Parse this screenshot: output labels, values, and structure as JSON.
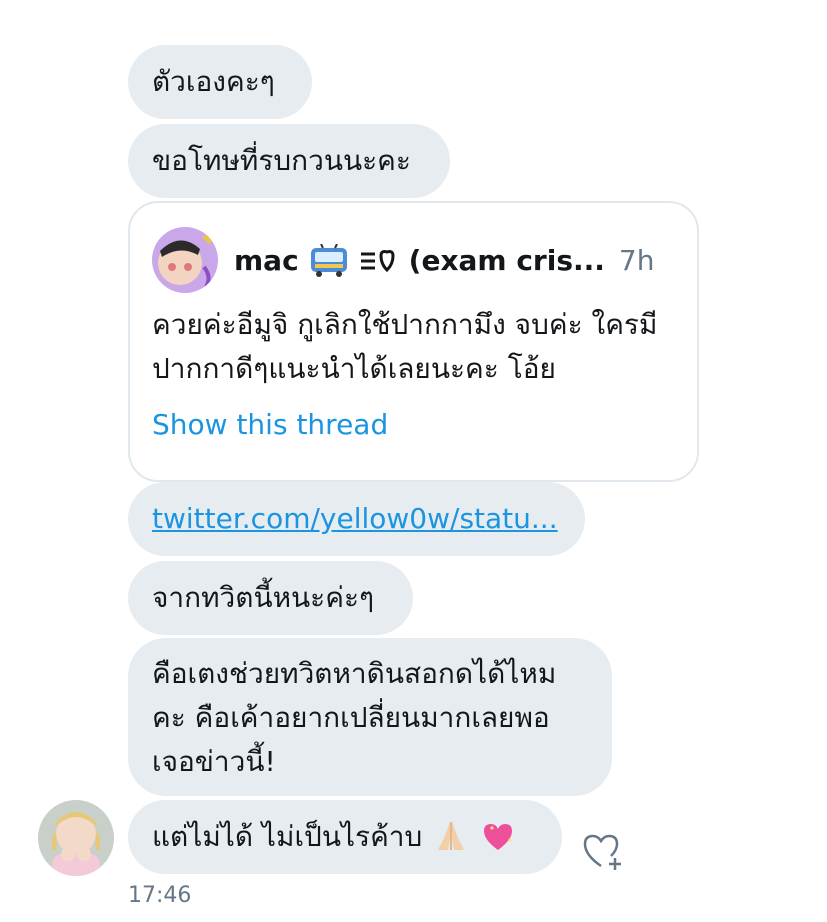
{
  "messages": [
    {
      "text": "ตัวเองคะๆ"
    },
    {
      "text": "ขอโทษที่รบกวนนะคะ"
    }
  ],
  "quote": {
    "name": "mac",
    "emoji": "bus-icon, trophy-icon",
    "handle": "(exam cris...",
    "time": "7h",
    "text": "ควยค่ะอีมูจิ กูเลิกใช้ปากกามึง จบค่ะ ใครมีปากกาดีๆแนะนำได้เลยนะคะ โอ้ย",
    "show_thread": "Show this thread"
  },
  "link": {
    "text": "twitter.com/yellow0w/statu..."
  },
  "messages2": [
    {
      "text": "จากทวิตนี้หนะค่ะๆ"
    },
    {
      "text": "คือเตงช่วยทวิตหาดินสอกดได้ไหมคะ คือเค้าอยากเปลี่ยนมากเลยพอเจอข่าวนี้!"
    },
    {
      "text": "แต่ไม่ได้ ไม่เป็นไรค้าบ"
    }
  ],
  "last_emoji": "folded-hands-icon, sparkling-heart-icon",
  "timestamp": "17:46"
}
